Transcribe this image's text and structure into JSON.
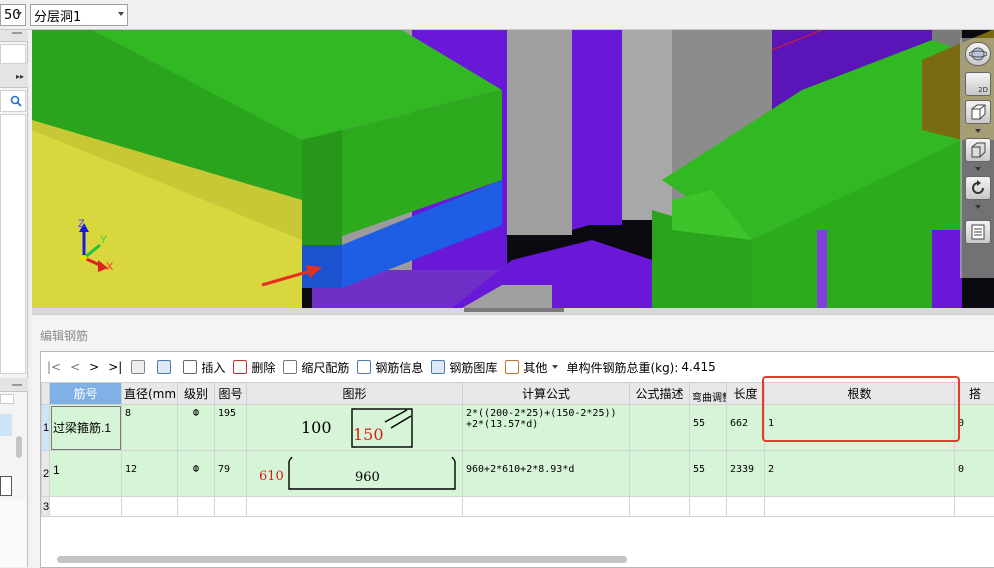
{
  "top": {
    "scale_value": "50",
    "layer_value": "分层洞1"
  },
  "panel": {
    "title": "编辑钢筋"
  },
  "toolbar": {
    "nav_first": "|<",
    "nav_prev": "<",
    "nav_next": ">",
    "nav_last": ">|",
    "insert": "插入",
    "delete": "删除",
    "scale_rebar": "缩尺配筋",
    "rebar_info": "钢筋信息",
    "rebar_library": "钢筋图库",
    "other": "其他",
    "total_weight_label": "单构件钢筋总重(kg):",
    "total_weight_value": "4.415"
  },
  "table": {
    "headers": {
      "name": "筋号",
      "diameter": "直径(mm)",
      "grade": "级别",
      "shape_no": "图号",
      "shape": "图形",
      "formula": "计算公式",
      "formula_desc": "公式描述",
      "bend_adjust": "弯曲调整",
      "length": "长度",
      "count": "根数",
      "extra": "搭"
    },
    "rows": [
      {
        "row_no": "1",
        "name": "过梁箍筋.1",
        "diameter": "8",
        "grade": "Ф",
        "shape_no": "195",
        "shape_a": "100",
        "shape_b": "150",
        "formula_line1": "2*((200-2*25)+(150-2*25))",
        "formula_line2": "+2*(13.57*d)",
        "formula_desc": "",
        "bend_adjust": "55",
        "length": "662",
        "count": "1",
        "extra": "0"
      },
      {
        "row_no": "2",
        "name": "1",
        "diameter": "12",
        "grade": "Ф",
        "shape_no": "79",
        "shape_a": "610",
        "shape_b": "960",
        "formula_line1": "960+2*610+2*8.93*d",
        "formula_line2": "",
        "formula_desc": "",
        "bend_adjust": "55",
        "length": "2339",
        "count": "2",
        "extra": "0"
      },
      {
        "row_no": "3"
      }
    ]
  },
  "viewport": {
    "axis_z": "Z",
    "axis_y": "Y",
    "axis_x": "X",
    "view_2d": "2D"
  },
  "colors": {
    "highlight_border": "#e53a2c",
    "row_green": "#d6f4d6",
    "header_selected": "#7fb0e6",
    "beam_green": "#2eaa1e",
    "wall_yellow": "#d4d43c",
    "column_purple": "#6a18d8",
    "slab_blue": "#1e5ee6",
    "red_text": "#d61e1e"
  }
}
